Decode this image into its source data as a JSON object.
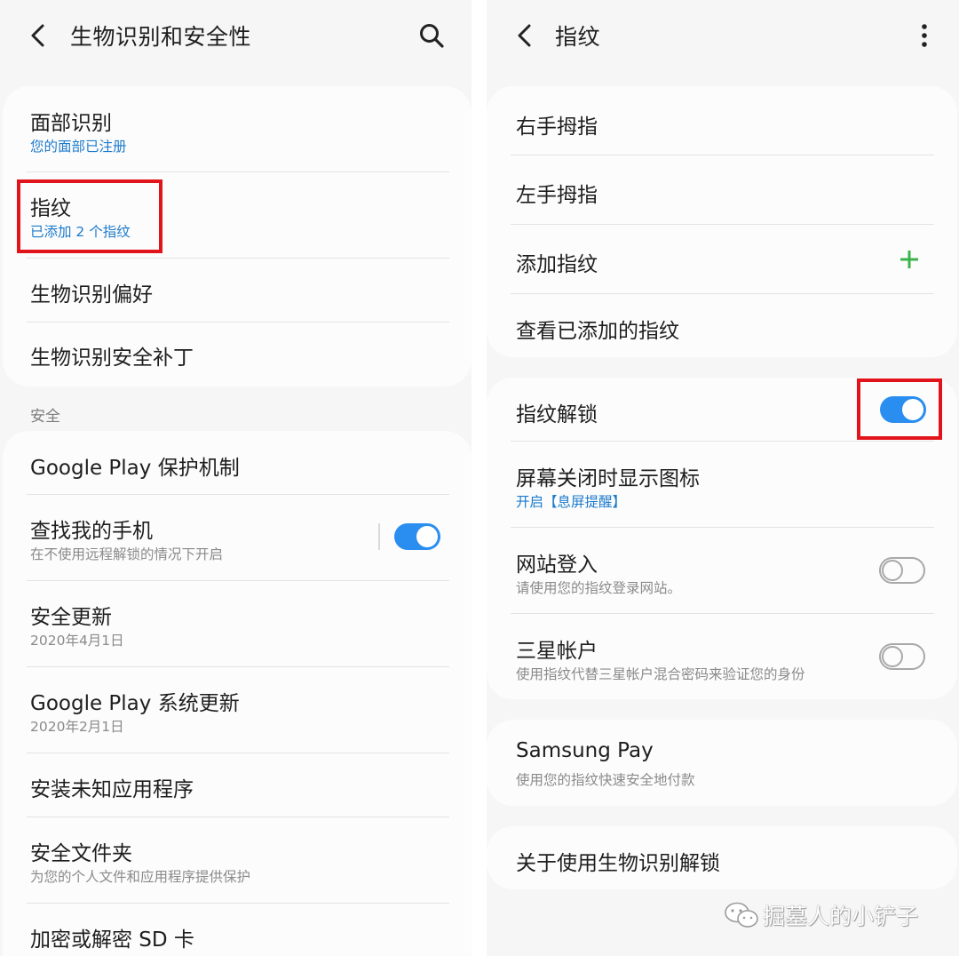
{
  "left": {
    "topbar": {
      "title": "生物识别和安全性"
    },
    "biometrics": [
      {
        "title": "面部识别",
        "subtitle": "您的面部已注册"
      },
      {
        "title": "指纹",
        "subtitle": "已添加 2 个指纹"
      },
      {
        "title": "生物识别偏好"
      },
      {
        "title": "生物识别安全补丁"
      }
    ],
    "security_header": "安全",
    "security": [
      {
        "title": "Google Play 保护机制"
      },
      {
        "title": "查找我的手机",
        "subtitle": "在不使用远程解锁的情况下开启",
        "toggle": true
      },
      {
        "title": "安全更新",
        "subtitle": "2020年4月1日"
      },
      {
        "title": "Google Play 系统更新",
        "subtitle": "2020年2月1日"
      },
      {
        "title": "安装未知应用程序"
      },
      {
        "title": "安全文件夹",
        "subtitle": "为您的个人文件和应用程序提供保护"
      },
      {
        "title": "加密或解密 SD 卡"
      }
    ]
  },
  "right": {
    "topbar": {
      "title": "指纹"
    },
    "fingerprints": [
      {
        "title": "右手拇指"
      },
      {
        "title": "左手拇指"
      },
      {
        "title": "添加指纹"
      },
      {
        "title": "查看已添加的指纹"
      }
    ],
    "options": [
      {
        "title": "指纹解锁",
        "toggle": true
      },
      {
        "title": "屏幕关闭时显示图标",
        "subtitle": "开启【息屏提醒】"
      },
      {
        "title": "网站登入",
        "subtitle": "请使用您的指纹登录网站。",
        "toggle": false
      },
      {
        "title": "三星帐户",
        "subtitle": "使用指纹代替三星帐户混合密码来验证您的身份",
        "toggle": false
      }
    ],
    "samsung_pay": {
      "title": "Samsung Pay",
      "subtitle": "使用您的指纹快速安全地付款"
    },
    "about": {
      "title": "关于使用生物识别解锁"
    }
  },
  "watermark": {
    "text": "掘墓人的小铲子"
  },
  "colors": {
    "accent_blue": "#1d7bcc",
    "toggle_on": "#2a8df0",
    "highlight_red": "#e2141b",
    "plus_green": "#3cb34a"
  },
  "icons": {
    "back": "back-arrow-icon",
    "search": "search-icon",
    "more": "more-vertical-icon",
    "add": "plus-icon",
    "brand": "wechat-icon"
  }
}
